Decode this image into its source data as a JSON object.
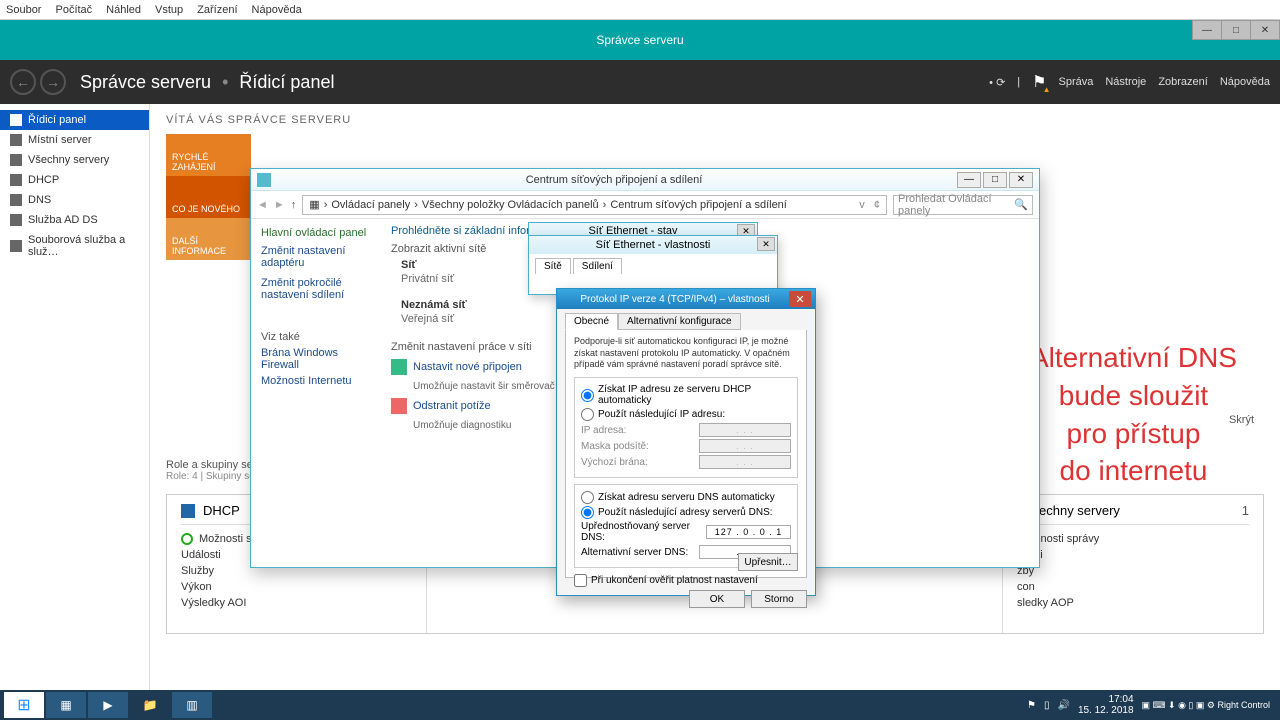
{
  "vm_menu": {
    "file": "Soubor",
    "machine": "Počítač",
    "view": "Náhled",
    "input": "Vstup",
    "devices": "Zařízení",
    "help": "Nápověda"
  },
  "titlebar": {
    "title": "Správce serveru"
  },
  "header": {
    "crumb1": "Správce serveru",
    "crumb2": "Řídicí panel",
    "manage": "Správa",
    "tools": "Nástroje",
    "view": "Zobrazení",
    "help": "Nápověda"
  },
  "sidebar": {
    "items": [
      {
        "label": "Řídicí panel"
      },
      {
        "label": "Místní server"
      },
      {
        "label": "Všechny servery"
      },
      {
        "label": "DHCP"
      },
      {
        "label": "DNS"
      },
      {
        "label": "Služba AD DS"
      },
      {
        "label": "Souborová služba a služ…"
      }
    ]
  },
  "welcome": "VÍTÁ VÁS SPRÁVCE SERVERU",
  "tiles": {
    "quick": "RYCHLÉ ZAHÁJENÍ",
    "new": "CO JE NOVÉHO",
    "more": "DALŠÍ INFORMACE"
  },
  "roles": {
    "title": "Role a skupiny serv",
    "sub": "Role: 4   |   Skupiny serv",
    "col1": {
      "title": "DHCP",
      "count": "1",
      "rows": [
        "Možnosti sp",
        "Události",
        "Služby",
        "Výkon",
        "Výsledky AOI"
      ]
    },
    "col2": {
      "title": "echny servery",
      "count": "1",
      "rows": [
        "žnosti správy",
        "álosti",
        "žby",
        "con",
        "sledky AOP"
      ]
    }
  },
  "explorer": {
    "title": "Centrum síťových připojení a sdílení",
    "path": {
      "p1": "Ovládací panely",
      "p2": "Všechny položky Ovládacích panelů",
      "p3": "Centrum síťových připojení a sdílení"
    },
    "search_ph": "Prohledat Ovládací panely",
    "side": {
      "main": "Hlavní ovládací panel",
      "adapter": "Změnit nastavení adaptéru",
      "sharing": "Změnit pokročilé nastavení sdílení",
      "see": "Viz také",
      "fw": "Brána Windows Firewall",
      "inet": "Možnosti Internetu"
    },
    "body": {
      "headline": "Prohlédněte si základní informace o síti a nastavte připojení.",
      "active": "Zobrazit aktivní sítě",
      "net": "Síť",
      "priv": "Privátní síť",
      "unk": "Neznámá síť",
      "pub": "Veřejná síť",
      "change": "Změnit nastavení práce v síti",
      "newconn": "Nastavit nové připojen",
      "newconn_sub": "Umožňuje nastavit šir\nsměrovač či přístupov",
      "diag": "Odstranit potíže",
      "diag_sub": "Umožňuje diagnostiku"
    }
  },
  "eth_prev_title": "Síť Ethernet - stav",
  "eth": {
    "title": "Síť Ethernet - vlastnosti",
    "tab1": "Sítě",
    "tab2": "Sdílení"
  },
  "ipdlg": {
    "title": "Protokol IP verze 4 (TCP/IPv4) – vlastnosti",
    "tab_general": "Obecné",
    "tab_alt": "Alternativní konfigurace",
    "desc": "Podporuje-li síť automatickou konfiguraci IP, je možné získat nastavení protokolu IP automaticky. V opačném případě vám správné nastavení poradí správce sítě.",
    "r1": "Získat IP adresu ze serveru DHCP automaticky",
    "r2": "Použít následující IP adresu:",
    "f_ip": "IP adresa:",
    "f_mask": "Maska podsítě:",
    "f_gw": "Výchozí brána:",
    "r3": "Získat adresu serveru DNS automaticky",
    "r4": "Použít následující adresy serverů DNS:",
    "f_dns1": "Upřednostňovaný server DNS:",
    "f_dns2": "Alternativní server DNS:",
    "dns1_val": "127 .   0 .   0 .   1",
    "dns2_val": ".       .       .",
    "validate": "Při ukončení ověřit platnost nastavení",
    "advanced": "Upřesnit…",
    "ok": "OK",
    "cancel": "Storno"
  },
  "annotation": {
    "l1": "Alternativní DNS",
    "l2": "bude sloužit",
    "l3": "pro přístup",
    "l4": "do internetu"
  },
  "hide": "Skrýt",
  "taskbar": {
    "time": "17:04",
    "date": "15. 12. 2018",
    "rc": "Right Control"
  }
}
